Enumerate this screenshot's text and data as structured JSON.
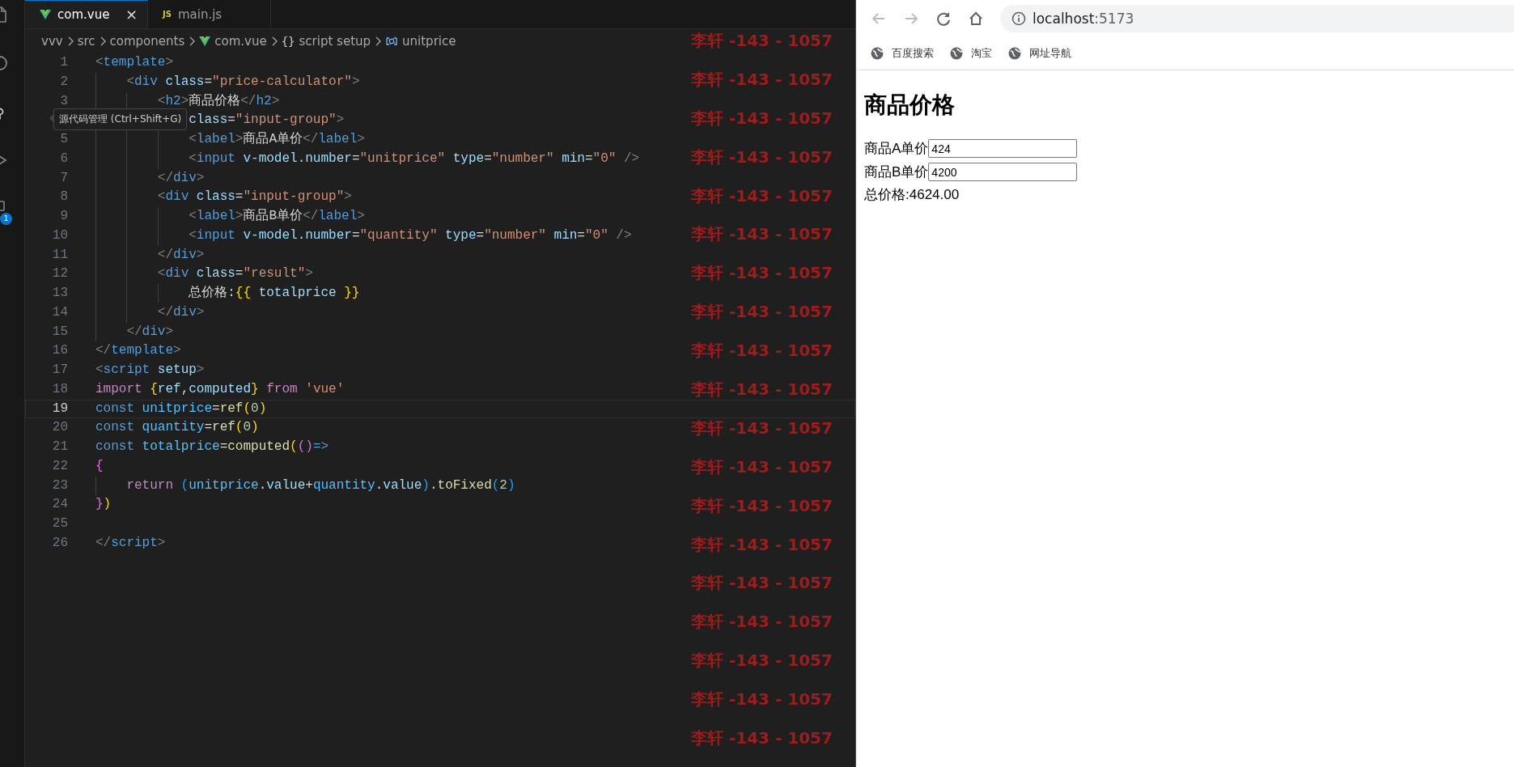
{
  "activity_bar": {
    "items": [
      {
        "kind": "files",
        "selected": false
      },
      {
        "kind": "search",
        "selected": false
      },
      {
        "kind": "source-control",
        "selected": false
      },
      {
        "kind": "run",
        "selected": false
      },
      {
        "kind": "extensions",
        "selected": false,
        "badge": "1"
      }
    ],
    "tooltip": "源代码管理 (Ctrl+Shift+G)"
  },
  "editor": {
    "tabs": [
      {
        "label": "com.vue",
        "kind": "vue",
        "selected": true,
        "close": "×"
      },
      {
        "label": "main.js",
        "kind": "js",
        "badge": "JS",
        "selected": false
      }
    ],
    "breadcrumbs": [
      {
        "label": "vvv"
      },
      {
        "label": "src"
      },
      {
        "label": "components"
      },
      {
        "label": "com.vue",
        "kind": "vue"
      },
      {
        "label": "script setup",
        "kind": "braces",
        "symbol": "{}"
      },
      {
        "label": "unitprice",
        "kind": "variable"
      }
    ],
    "lines": [
      {
        "number": "1",
        "current": false,
        "tokens": [
          {
            "kind": "punct",
            "text": "<"
          },
          {
            "kind": "tag",
            "text": "template"
          },
          {
            "kind": "punct",
            "text": ">"
          }
        ]
      },
      {
        "number": "2",
        "current": false,
        "tokens": [
          {
            "kind": "punct",
            "text": "    <"
          },
          {
            "kind": "tag",
            "text": "div"
          },
          {
            "kind": "attr",
            "text": " class"
          },
          {
            "kind": "op",
            "text": "="
          },
          {
            "kind": "str",
            "text": "\"price-calculator\""
          },
          {
            "kind": "punct",
            "text": ">"
          }
        ]
      },
      {
        "number": "3",
        "current": false,
        "tokens": [
          {
            "kind": "punct",
            "text": "        <"
          },
          {
            "kind": "tag",
            "text": "h2"
          },
          {
            "kind": "punct",
            "text": ">"
          },
          {
            "kind": "text",
            "text": "商品价格"
          },
          {
            "kind": "punct",
            "text": "</"
          },
          {
            "kind": "tag",
            "text": "h2"
          },
          {
            "kind": "punct",
            "text": ">"
          }
        ]
      },
      {
        "current": false,
        "tokens": [
          {
            "kind": "attr",
            "text": "             class"
          },
          {
            "kind": "op",
            "text": "="
          },
          {
            "kind": "str",
            "text": "\"input-group\""
          },
          {
            "kind": "punct",
            "text": ">"
          }
        ]
      },
      {
        "number": "5",
        "current": false,
        "tokens": [
          {
            "kind": "punct",
            "text": "            <"
          },
          {
            "kind": "tag",
            "text": "label"
          },
          {
            "kind": "punct",
            "text": ">"
          },
          {
            "kind": "text",
            "text": "商品A单价"
          },
          {
            "kind": "punct",
            "text": "</"
          },
          {
            "kind": "tag",
            "text": "label"
          },
          {
            "kind": "punct",
            "text": ">"
          }
        ]
      },
      {
        "number": "6",
        "current": false,
        "tokens": [
          {
            "kind": "punct",
            "text": "            <"
          },
          {
            "kind": "tag",
            "text": "input"
          },
          {
            "kind": "attr",
            "text": " v-model.number"
          },
          {
            "kind": "op",
            "text": "="
          },
          {
            "kind": "str",
            "text": "\"unitprice\""
          },
          {
            "kind": "attr",
            "text": " type"
          },
          {
            "kind": "op",
            "text": "="
          },
          {
            "kind": "str",
            "text": "\"number\""
          },
          {
            "kind": "attr",
            "text": " min"
          },
          {
            "kind": "op",
            "text": "="
          },
          {
            "kind": "str",
            "text": "\"0\""
          },
          {
            "kind": "punct",
            "text": " />"
          }
        ]
      },
      {
        "number": "7",
        "current": false,
        "tokens": [
          {
            "kind": "punct",
            "text": "        </"
          },
          {
            "kind": "tag",
            "text": "div"
          },
          {
            "kind": "punct",
            "text": ">"
          }
        ]
      },
      {
        "number": "8",
        "current": false,
        "tokens": [
          {
            "kind": "punct",
            "text": "        <"
          },
          {
            "kind": "tag",
            "text": "div"
          },
          {
            "kind": "attr",
            "text": " class"
          },
          {
            "kind": "op",
            "text": "="
          },
          {
            "kind": "str",
            "text": "\"input-group\""
          },
          {
            "kind": "punct",
            "text": ">"
          }
        ]
      },
      {
        "number": "9",
        "current": false,
        "tokens": [
          {
            "kind": "punct",
            "text": "            <"
          },
          {
            "kind": "tag",
            "text": "label"
          },
          {
            "kind": "punct",
            "text": ">"
          },
          {
            "kind": "text",
            "text": "商品B单价"
          },
          {
            "kind": "punct",
            "text": "</"
          },
          {
            "kind": "tag",
            "text": "label"
          },
          {
            "kind": "punct",
            "text": ">"
          }
        ]
      },
      {
        "number": "10",
        "current": false,
        "tokens": [
          {
            "kind": "punct",
            "text": "            <"
          },
          {
            "kind": "tag",
            "text": "input"
          },
          {
            "kind": "attr",
            "text": " v-model.number"
          },
          {
            "kind": "op",
            "text": "="
          },
          {
            "kind": "str",
            "text": "\"quantity\""
          },
          {
            "kind": "attr",
            "text": " type"
          },
          {
            "kind": "op",
            "text": "="
          },
          {
            "kind": "str",
            "text": "\"number\""
          },
          {
            "kind": "attr",
            "text": " min"
          },
          {
            "kind": "op",
            "text": "="
          },
          {
            "kind": "str",
            "text": "\"0\""
          },
          {
            "kind": "punct",
            "text": " />"
          }
        ]
      },
      {
        "number": "11",
        "current": false,
        "tokens": [
          {
            "kind": "punct",
            "text": "        </"
          },
          {
            "kind": "tag",
            "text": "div"
          },
          {
            "kind": "punct",
            "text": ">"
          }
        ]
      },
      {
        "number": "12",
        "current": false,
        "tokens": [
          {
            "kind": "punct",
            "text": "        <"
          },
          {
            "kind": "tag",
            "text": "div"
          },
          {
            "kind": "attr",
            "text": " class"
          },
          {
            "kind": "op",
            "text": "="
          },
          {
            "kind": "str",
            "text": "\"result\""
          },
          {
            "kind": "punct",
            "text": ">"
          }
        ]
      },
      {
        "number": "13",
        "current": false,
        "tokens": [
          {
            "kind": "text",
            "text": "            总价格:"
          },
          {
            "kind": "brace1",
            "text": "{{"
          },
          {
            "kind": "attr",
            "text": " totalprice"
          },
          {
            "kind": "brace1",
            "text": " }}"
          }
        ]
      },
      {
        "number": "14",
        "current": false,
        "tokens": [
          {
            "kind": "punct",
            "text": "        </"
          },
          {
            "kind": "tag",
            "text": "div"
          },
          {
            "kind": "punct",
            "text": ">"
          }
        ]
      },
      {
        "number": "15",
        "current": false,
        "tokens": [
          {
            "kind": "punct",
            "text": "    </"
          },
          {
            "kind": "tag",
            "text": "div"
          },
          {
            "kind": "punct",
            "text": ">"
          }
        ]
      },
      {
        "number": "16",
        "current": false,
        "tokens": [
          {
            "kind": "punct",
            "text": "</"
          },
          {
            "kind": "tag",
            "text": "template"
          },
          {
            "kind": "punct",
            "text": ">"
          }
        ]
      },
      {
        "number": "17",
        "current": false,
        "tokens": [
          {
            "kind": "punct",
            "text": "<"
          },
          {
            "kind": "tag",
            "text": "script"
          },
          {
            "kind": "attr",
            "text": " setup"
          },
          {
            "kind": "punct",
            "text": ">"
          }
        ]
      },
      {
        "number": "18",
        "current": false,
        "tokens": [
          {
            "kind": "kw",
            "text": "import"
          },
          {
            "kind": "brace1",
            "text": " {"
          },
          {
            "kind": "attr",
            "text": "ref"
          },
          {
            "kind": "text",
            "text": ","
          },
          {
            "kind": "attr",
            "text": "computed"
          },
          {
            "kind": "brace1",
            "text": "}"
          },
          {
            "kind": "kw",
            "text": " from"
          },
          {
            "kind": "str",
            "text": " 'vue'"
          }
        ]
      },
      {
        "number": "19",
        "current": true,
        "tokens": [
          {
            "kind": "decl",
            "text": "const"
          },
          {
            "kind": "const",
            "text": " unitprice"
          },
          {
            "kind": "text",
            "text": "="
          },
          {
            "kind": "fn",
            "text": "ref"
          },
          {
            "kind": "brace1",
            "text": "("
          },
          {
            "kind": "num",
            "text": "0"
          },
          {
            "kind": "brace1",
            "text": ")"
          }
        ]
      },
      {
        "number": "20",
        "current": false,
        "tokens": [
          {
            "kind": "decl",
            "text": "const"
          },
          {
            "kind": "const",
            "text": " quantity"
          },
          {
            "kind": "text",
            "text": "="
          },
          {
            "kind": "fn",
            "text": "ref"
          },
          {
            "kind": "brace1",
            "text": "("
          },
          {
            "kind": "num",
            "text": "0"
          },
          {
            "kind": "brace1",
            "text": ")"
          }
        ]
      },
      {
        "number": "21",
        "current": false,
        "tokens": [
          {
            "kind": "decl",
            "text": "const"
          },
          {
            "kind": "const",
            "text": " totalprice"
          },
          {
            "kind": "text",
            "text": "="
          },
          {
            "kind": "fn",
            "text": "computed"
          },
          {
            "kind": "brace1",
            "text": "("
          },
          {
            "kind": "brace2",
            "text": "()"
          },
          {
            "kind": "decl",
            "text": "=>"
          }
        ]
      },
      {
        "number": "22",
        "current": false,
        "tokens": [
          {
            "kind": "brace2",
            "text": "{"
          }
        ]
      },
      {
        "number": "23",
        "current": false,
        "tokens": [
          {
            "kind": "kw",
            "text": "    return"
          },
          {
            "kind": "brace3",
            "text": " ("
          },
          {
            "kind": "const",
            "text": "unitprice"
          },
          {
            "kind": "text",
            "text": "."
          },
          {
            "kind": "attr",
            "text": "value"
          },
          {
            "kind": "text",
            "text": "+"
          },
          {
            "kind": "const",
            "text": "quantity"
          },
          {
            "kind": "text",
            "text": "."
          },
          {
            "kind": "attr",
            "text": "value"
          },
          {
            "kind": "brace3",
            "text": ")"
          },
          {
            "kind": "text",
            "text": "."
          },
          {
            "kind": "fn",
            "text": "toFixed"
          },
          {
            "kind": "brace3",
            "text": "("
          },
          {
            "kind": "num",
            "text": "2"
          },
          {
            "kind": "brace3",
            "text": ")"
          }
        ]
      },
      {
        "number": "24",
        "current": false,
        "tokens": [
          {
            "kind": "brace2",
            "text": "}"
          },
          {
            "kind": "brace1",
            "text": ")"
          }
        ]
      },
      {
        "number": "25",
        "current": false
      },
      {
        "number": "26",
        "current": false,
        "tokens": [
          {
            "kind": "punct",
            "text": "</"
          },
          {
            "kind": "tag",
            "text": "script"
          },
          {
            "kind": "punct",
            "text": ">"
          }
        ]
      }
    ]
  },
  "overlay_labels": [
    "李轩 -143 - 1057",
    "李轩 -143 - 1057",
    "李轩 -143 - 1057",
    "李轩 -143 - 1057",
    "李轩 -143 - 1057",
    "李轩 -143 - 1057",
    "李轩 -143 - 1057",
    "李轩 -143 - 1057",
    "李轩 -143 - 1057",
    "李轩 -143 - 1057",
    "李轩 -143 - 1057",
    "李轩 -143 - 1057",
    "李轩 -143 - 1057",
    "李轩 -143 - 1057",
    "李轩 -143 - 1057",
    "李轩 -143 - 1057",
    "李轩 -143 - 1057",
    "李轩 -143 - 1057",
    "李轩 -143 - 1057"
  ],
  "browser": {
    "nav": [
      {
        "kind": "back",
        "disabled": true
      },
      {
        "kind": "forward",
        "disabled": true
      },
      {
        "kind": "reload",
        "disabled": false
      },
      {
        "kind": "home",
        "disabled": false
      }
    ],
    "address": {
      "host": "localhost",
      "port": ":5173"
    },
    "bookmarks": [
      {
        "label": "百度搜索"
      },
      {
        "label": "淘宝"
      },
      {
        "label": "网址导航"
      }
    ],
    "page": {
      "heading": "商品价格",
      "fields": [
        {
          "label": "商品A单价",
          "value": "424"
        },
        {
          "label": "商品B单价",
          "value": "4200"
        }
      ],
      "result": "总价格:4624.00"
    }
  }
}
